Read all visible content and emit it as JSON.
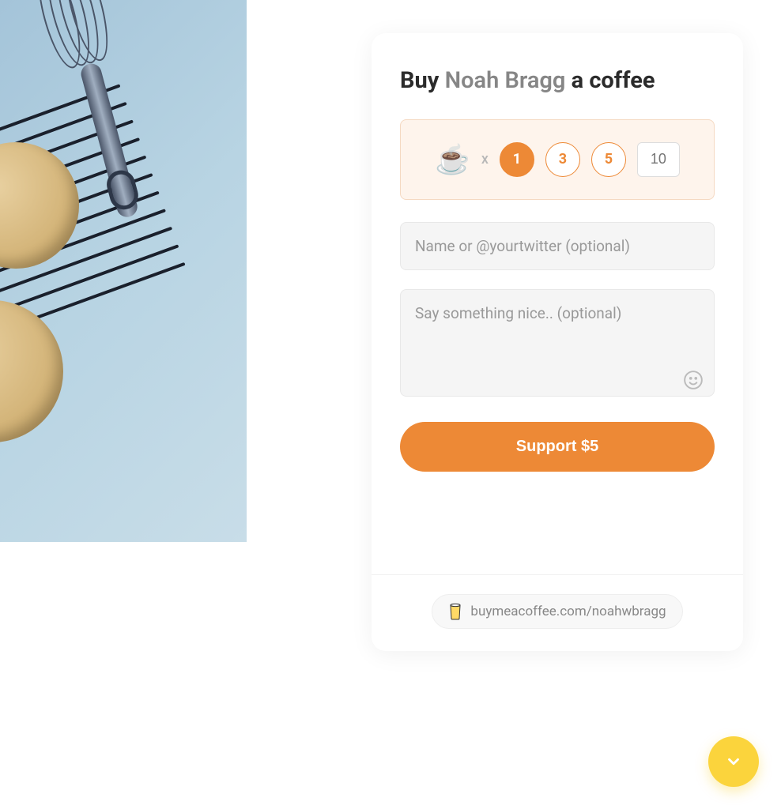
{
  "title": {
    "prefix": "Buy ",
    "name": "Noah Bragg",
    "suffix": " a coffee"
  },
  "quantity": {
    "icon": "☕",
    "times": "x",
    "options": [
      "1",
      "3",
      "5"
    ],
    "selected": "1",
    "custom_placeholder": "10"
  },
  "inputs": {
    "name_placeholder": "Name or @yourtwitter (optional)",
    "message_placeholder": "Say something nice.. (optional)"
  },
  "support_button": "Support $5",
  "profile_link": "buymeacoffee.com/noahwbragg",
  "colors": {
    "accent": "#ed8936",
    "fab": "#fbd43c"
  }
}
